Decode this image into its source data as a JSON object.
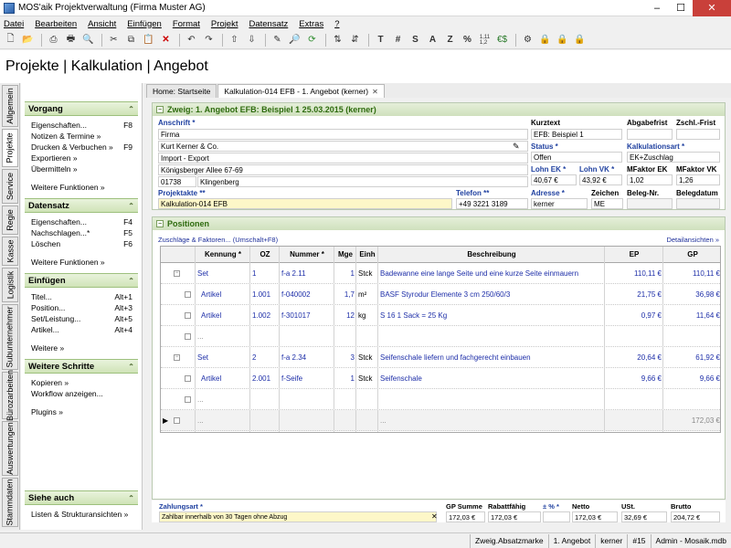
{
  "window": {
    "title": "MOS'aik Projektverwaltung (Firma Muster AG)",
    "min": "–",
    "max": "☐",
    "close": "✕"
  },
  "menu": [
    "Datei",
    "Bearbeiten",
    "Ansicht",
    "Einfügen",
    "Format",
    "Projekt",
    "Datensatz",
    "Extras",
    "?"
  ],
  "toolbar_text": {
    "t": "T",
    "hash": "#",
    "s": "S",
    "a": "A",
    "z": "Z",
    "pct": "%",
    "dec": "1,11\n1,2",
    "euro": "€$"
  },
  "page_title": "Projekte | Kalkulation | Angebot",
  "left_tabs": [
    "Allgemein",
    "Projekte",
    "Service",
    "Regie",
    "Kasse",
    "Logistik",
    "Subunternehmer",
    "Bürozarbeiten",
    "Auswertungen",
    "Stammdaten"
  ],
  "sidebar": {
    "vorgang": {
      "title": "Vorgang",
      "items": [
        [
          "Eigenschaften...",
          "F8"
        ],
        [
          "Notizen & Termine »",
          ""
        ],
        [
          "Drucken & Verbuchen »",
          "F9"
        ],
        [
          "Exportieren »",
          ""
        ],
        [
          "Übermitteln »",
          ""
        ]
      ],
      "more": "Weitere Funktionen »"
    },
    "datensatz": {
      "title": "Datensatz",
      "items": [
        [
          "Eigenschaften...",
          "F4"
        ],
        [
          "Nachschlagen...*",
          "F5"
        ],
        [
          "Löschen",
          "F6"
        ]
      ],
      "more": "Weitere Funktionen »"
    },
    "einfuegen": {
      "title": "Einfügen",
      "items": [
        [
          "Titel...",
          "Alt+1"
        ],
        [
          "Position...",
          "Alt+3"
        ],
        [
          "Set/Leistung...",
          "Alt+5"
        ],
        [
          "Artikel...",
          "Alt+4"
        ]
      ],
      "more": "Weitere »"
    },
    "weitere": {
      "title": "Weitere Schritte",
      "items": [
        [
          "Kopieren »",
          ""
        ],
        [
          "Workflow anzeigen...",
          ""
        ]
      ],
      "more": "Plugins »"
    },
    "siehe": {
      "title": "Siehe auch",
      "items": [
        [
          "Listen & Strukturansichten »",
          ""
        ]
      ]
    }
  },
  "work_tabs": [
    "Home: Startseite",
    "Kalkulation-014 EFB - 1. Angebot (kerner)"
  ],
  "panel1": {
    "header": "Zweig: 1. Angebot EFB: Beispiel 1 25.03.2015 (kerner)",
    "anschrift_label": "Anschrift *",
    "anschrift": [
      "Firma",
      "Kurt Kerner & Co.",
      "Import - Export",
      "Königsberger Allee 67-69"
    ],
    "plz": "01738",
    "ort": "Klingenberg",
    "projektakte_label": "Projektakte **",
    "projektakte": "Kalkulation-014 EFB",
    "telefon_label": "Telefon **",
    "telefon": "+49 3221 3189",
    "kurztext_label": "Kurztext",
    "kurztext": "EFB: Beispiel 1",
    "abgabefrist_label": "Abgabefrist",
    "zschl_label": "Zschl.-Frist",
    "status_label": "Status *",
    "status": "Offen",
    "kalkart_label": "Kalkulationsart *",
    "kalkart": "EK+Zuschlag",
    "lohnek_label": "Lohn EK *",
    "lohnek": "40,67 €",
    "lohnvk_label": "Lohn VK *",
    "lohnvk": "43,92 €",
    "mfek_label": "MFaktor EK",
    "mfek": "1,02",
    "mfvk_label": "MFaktor VK",
    "mfvk": "1,26",
    "adresse_label": "Adresse *",
    "adresse": "kerner",
    "zeichen_label": "Zeichen",
    "zeichen": "ME",
    "belegnr_label": "Beleg-Nr.",
    "belegdatum_label": "Belegdatum"
  },
  "panel2": {
    "header": "Positionen",
    "link_left": "Zuschläge & Faktoren... (Umschalt+F8)",
    "link_right": "Detailansichten »",
    "columns": [
      "Kennung *",
      "OZ",
      "Nummer *",
      "Mge",
      "Einh",
      "Beschreibung",
      "EP",
      "GP"
    ],
    "rows": [
      {
        "k": "Set",
        "oz": "1",
        "nr": "f-a 2.11",
        "mge": "1",
        "einh": "Stck",
        "desc": "Badewanne eine lange Seite und eine kurze Seite einmauern",
        "ep": "110,11 €",
        "gp": "110,11 €"
      },
      {
        "k": "Artikel",
        "oz": "1.001",
        "nr": "f-040002",
        "mge": "1,7",
        "einh": "m²",
        "desc": "BASF Styrodur Elemente 3 cm 250/60/3",
        "ep": "21,75 €",
        "gp": "36,98 €"
      },
      {
        "k": "Artikel",
        "oz": "1.002",
        "nr": "f-301017",
        "mge": "12",
        "einh": "kg",
        "desc": "S 16 1 Sack = 25 Kg",
        "ep": "0,97 €",
        "gp": "11,64 €"
      },
      {
        "k": "...",
        "oz": "",
        "nr": "",
        "mge": "",
        "einh": "",
        "desc": "",
        "ep": "",
        "gp": ""
      },
      {
        "k": "Set",
        "oz": "2",
        "nr": "f-a 2.34",
        "mge": "3",
        "einh": "Stck",
        "desc": "Seifenschale liefern und fachgerecht einbauen",
        "ep": "20,64 €",
        "gp": "61,92 €"
      },
      {
        "k": "Artikel",
        "oz": "2.001",
        "nr": "f-Seife",
        "mge": "1",
        "einh": "Stck",
        "desc": "Seifenschale",
        "ep": "9,66 €",
        "gp": "9,66 €"
      },
      {
        "k": "...",
        "oz": "",
        "nr": "",
        "mge": "",
        "einh": "",
        "desc": "",
        "ep": "",
        "gp": ""
      },
      {
        "k": "...",
        "oz": "",
        "nr": "",
        "mge": "",
        "einh": "",
        "desc": "...",
        "ep": "",
        "gp": "172,03 €"
      }
    ]
  },
  "footer": {
    "zahlungsart_label": "Zahlungsart *",
    "zahlungsart": "Zahlbar innerhalb von 30 Tagen ohne Abzug",
    "gpsumme_label": "GP Summe",
    "gpsumme": "172,03 €",
    "rabatt_label": "Rabattfähig",
    "rabatt": "172,03 €",
    "pct_label": "± % *",
    "pct": "",
    "netto_label": "Netto",
    "netto": "172,03 €",
    "ust_label": "USt.",
    "ust": "32,69 €",
    "brutto_label": "Brutto",
    "brutto": "204,72 €"
  },
  "status": [
    "Zweig.Absatzmarke",
    "1. Angebot",
    "kerner",
    "#15",
    "Admin - Mosaik.mdb"
  ]
}
